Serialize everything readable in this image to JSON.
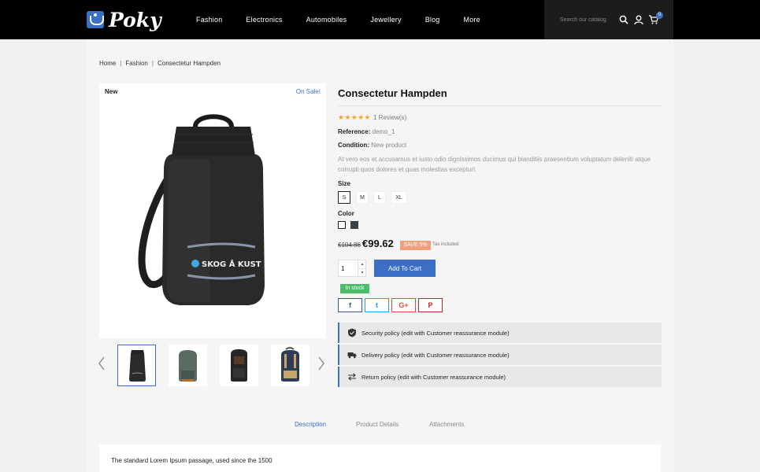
{
  "header": {
    "logo_text": "Poky",
    "nav": [
      "Fashion",
      "Electronics",
      "Automobiles",
      "Jewellery",
      "Blog",
      "More"
    ],
    "search_placeholder": "Search our catalog",
    "cart_count": "0"
  },
  "breadcrumb": [
    "Home",
    "Fashion",
    "Consectetur Hampden"
  ],
  "product": {
    "flag_new": "New",
    "flag_sale": "On Sale!",
    "bag_brand": "SKOG Å KUST",
    "title": "Consectetur Hampden",
    "stars": "★★★★★",
    "reviews": "1 Review(s)",
    "reference_label": "Reference:",
    "reference_value": "demo_1",
    "condition_label": "Condition:",
    "condition_value": "New product",
    "description": "At vero eos et accusamus et iusto odio dignissimos ducimus qui blanditiis praesentium voluptatum deleniti atque corrupti quos dolores et quas molestias excepturi.",
    "size_label": "Size",
    "sizes": [
      "S",
      "M",
      "L",
      "XL"
    ],
    "selected_size": "S",
    "color_label": "Color",
    "colors": [
      "#ffffff",
      "#3a4149"
    ],
    "old_price": "€104.86",
    "price": "€99.62",
    "save_badge": "SAVE 5%",
    "tax": "Tax included",
    "quantity": "1",
    "add_to_cart": "Add To Cart",
    "stock": "In stock"
  },
  "social": [
    {
      "name": "facebook",
      "glyph": "f",
      "color": "#3b5998"
    },
    {
      "name": "twitter",
      "glyph": "t",
      "color": "#1da1f2"
    },
    {
      "name": "google-plus",
      "glyph": "G+",
      "color": "#dd4b39"
    },
    {
      "name": "pinterest",
      "glyph": "P",
      "color": "#cb2027"
    }
  ],
  "reassurance": [
    "Security policy (edit with Customer reassurance module)",
    "Delivery policy (edit with Customer reassurance module)",
    "Return policy (edit with Customer reassurance module)"
  ],
  "tabs": [
    "Description",
    "Product Details",
    "Attachments"
  ],
  "active_tab": "Description",
  "description_panel_text": "The standard Lorem Ipsum passage, used since the 1500",
  "accent_color": "#3a6fc4"
}
